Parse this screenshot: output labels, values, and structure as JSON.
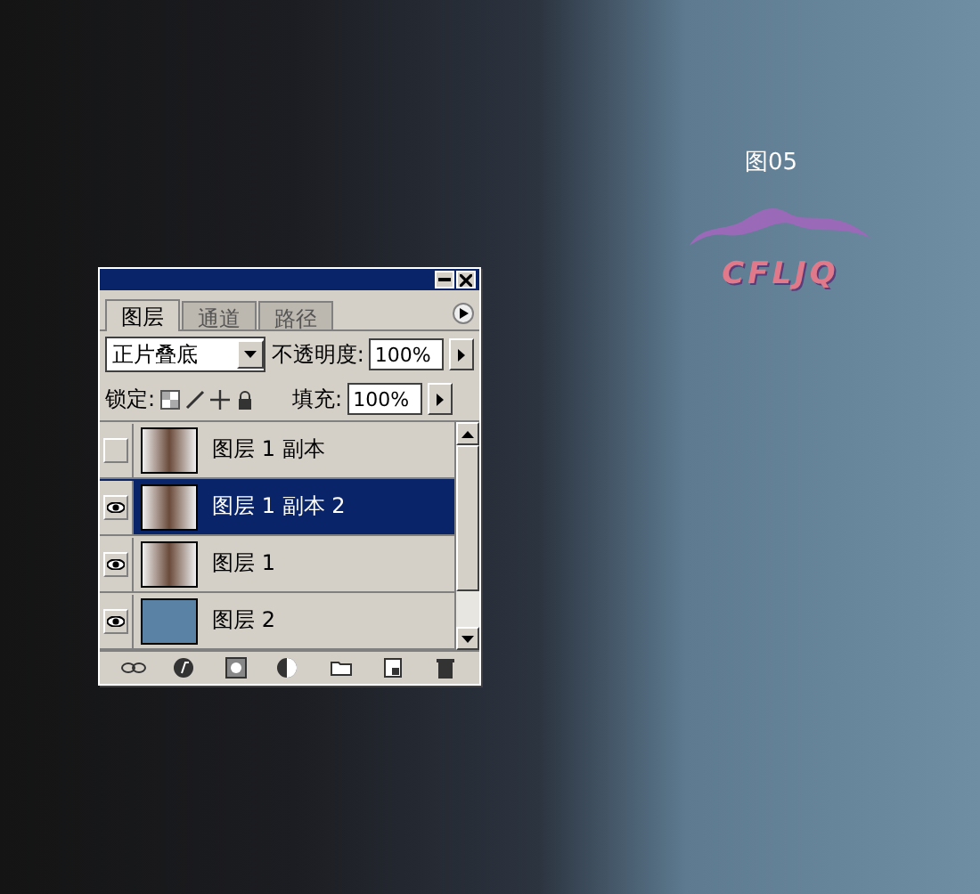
{
  "figure_label": "图05",
  "logo": {
    "text": "CFLJQ"
  },
  "panel": {
    "tabs": [
      {
        "label": "图层",
        "selected": true
      },
      {
        "label": "通道",
        "selected": false
      },
      {
        "label": "路径",
        "selected": false
      }
    ],
    "blend_mode": "正片叠底",
    "opacity_label": "不透明度:",
    "opacity": "100%",
    "lock_label": "锁定:",
    "fill_label": "填充:",
    "fill": "100%",
    "layers": [
      {
        "name": "图层 1 副本",
        "visible": false,
        "selected": false,
        "kind": "photo"
      },
      {
        "name": "图层 1 副本 2",
        "visible": true,
        "selected": true,
        "kind": "photo"
      },
      {
        "name": "图层 1",
        "visible": true,
        "selected": false,
        "kind": "photo"
      },
      {
        "name": "图层 2",
        "visible": true,
        "selected": false,
        "kind": "fill"
      }
    ]
  }
}
